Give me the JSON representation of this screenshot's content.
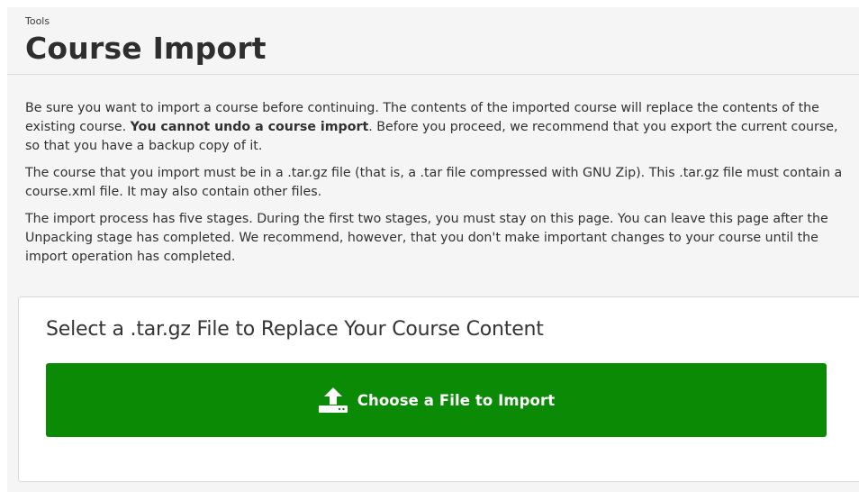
{
  "breadcrumb": "Tools",
  "page_title": "Course Import",
  "intro": {
    "p1_before": "Be sure you want to import a course before continuing. The contents of the imported course will replace the contents of the existing course. ",
    "p1_bold": "You cannot undo a course import",
    "p1_after": ". Before you proceed, we recommend that you export the current course, so that you have a backup copy of it.",
    "p2": "The course that you import must be in a .tar.gz file (that is, a .tar file compressed with GNU Zip). This .tar.gz file must contain a course.xml file. It may also contain other files.",
    "p3": "The import process has five stages. During the first two stages, you must stay on this page. You can leave this page after the Unpacking stage has completed. We recommend, however, that you don't make important changes to your course until the import operation has completed."
  },
  "import_card": {
    "title": "Select a .tar.gz File to Replace Your Course Content",
    "button_label": "Choose a File to Import",
    "button_icon": "upload-icon",
    "button_color": "#0b8a06"
  }
}
